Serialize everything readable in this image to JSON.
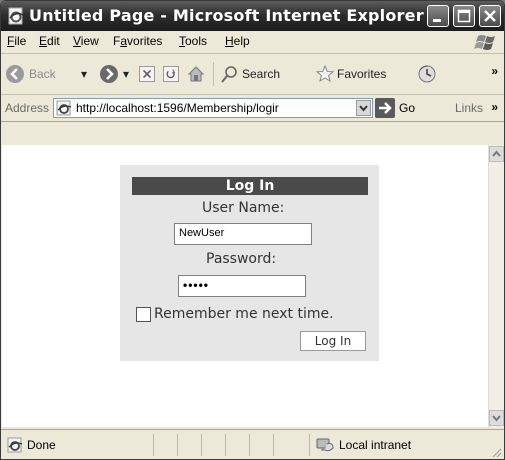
{
  "window": {
    "title": "Untitled Page - Microsoft Internet Explorer"
  },
  "menu": [
    {
      "label": "File",
      "accel": "F",
      "rest": "ile"
    },
    {
      "label": "Edit",
      "accel": "E",
      "rest": "dit"
    },
    {
      "label": "View",
      "accel": "V",
      "rest": "iew"
    },
    {
      "label": "Favorites",
      "accel": "a",
      "pre": "F",
      "rest": "vorites"
    },
    {
      "label": "Tools",
      "accel": "T",
      "rest": "ools"
    },
    {
      "label": "Help",
      "accel": "H",
      "rest": "elp"
    }
  ],
  "toolbar": {
    "back_label": "Back",
    "search_label": "Search",
    "favorites_label": "Favorites"
  },
  "address": {
    "label": "Address",
    "url": "http://localhost:1596/Membership/logir",
    "go_label": "Go",
    "links_label": "Links"
  },
  "login": {
    "header": "Log In",
    "username_label": "User Name:",
    "username_value": "NewUser",
    "password_label": "Password:",
    "password_value": "•••••",
    "remember_label": "Remember me next time.",
    "remember_checked": false,
    "button_label": "Log In"
  },
  "status": {
    "text": "Done",
    "zone": "Local intranet"
  }
}
